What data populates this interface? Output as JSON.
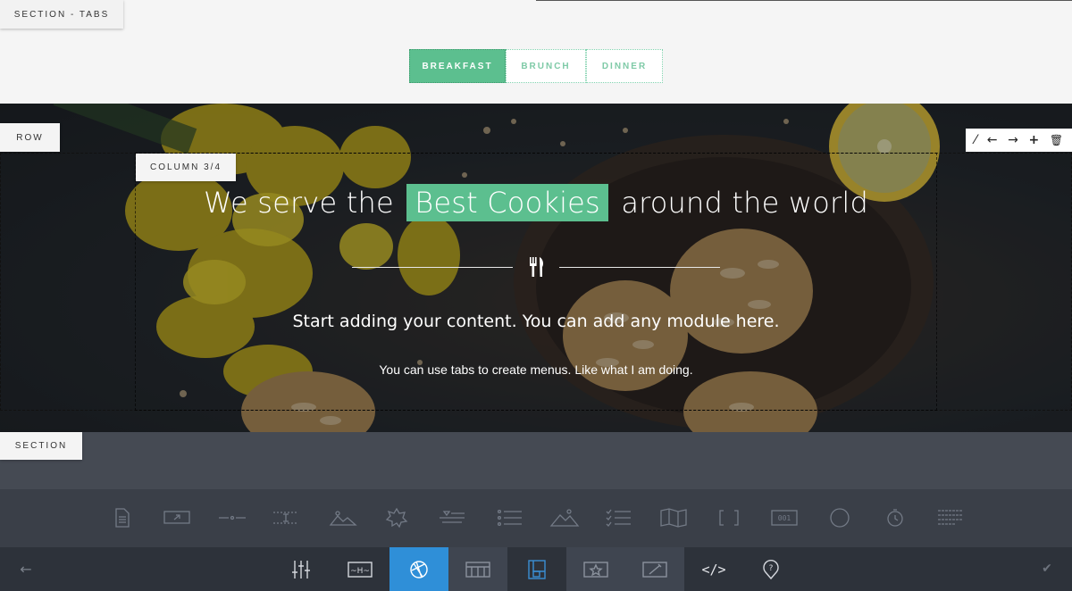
{
  "labels": {
    "section_tabs": "SECTION - TABS",
    "row": "ROW",
    "column": "COLUMN 3/4",
    "section": "SECTION"
  },
  "tabs": [
    {
      "label": "BREAKFAST",
      "active": true
    },
    {
      "label": "BRUNCH",
      "active": false
    },
    {
      "label": "DINNER",
      "active": false
    }
  ],
  "row_tools": [
    "wand-icon",
    "arrow-left-icon",
    "arrow-right-icon",
    "plus-icon",
    "trash-icon"
  ],
  "hero": {
    "title_before": "We serve the",
    "title_highlight": "Best Cookies",
    "title_after": "around the world",
    "subtitle": "Start adding your content. You can add any module here.",
    "small_text": "You can use tabs to create menus. Like what I am doing."
  },
  "modules": [
    "text-module-icon",
    "button-module-icon",
    "divider-module-icon",
    "spacer-module-icon",
    "image-module-icon",
    "icon-module-icon",
    "icon-list-module-icon",
    "list-module-icon",
    "gallery-module-icon",
    "checklist-module-icon",
    "map-module-icon",
    "shortcode-module-icon",
    "counter-module-icon",
    "progress-circle-module-icon",
    "countdown-module-icon",
    "tabs-module-icon"
  ],
  "toolbar": {
    "items": [
      "settings-sliders-icon",
      "heading-icon",
      "globe-icon",
      "table-icon",
      "layout-icon",
      "rating-icon",
      "edit-image-icon",
      "code-icon",
      "map-pin-help-icon"
    ],
    "code_label": "</>"
  },
  "colors": {
    "accent": "#5cbf8f",
    "toolbar": "#2d323a",
    "active_tool": "#2f8fd8"
  }
}
